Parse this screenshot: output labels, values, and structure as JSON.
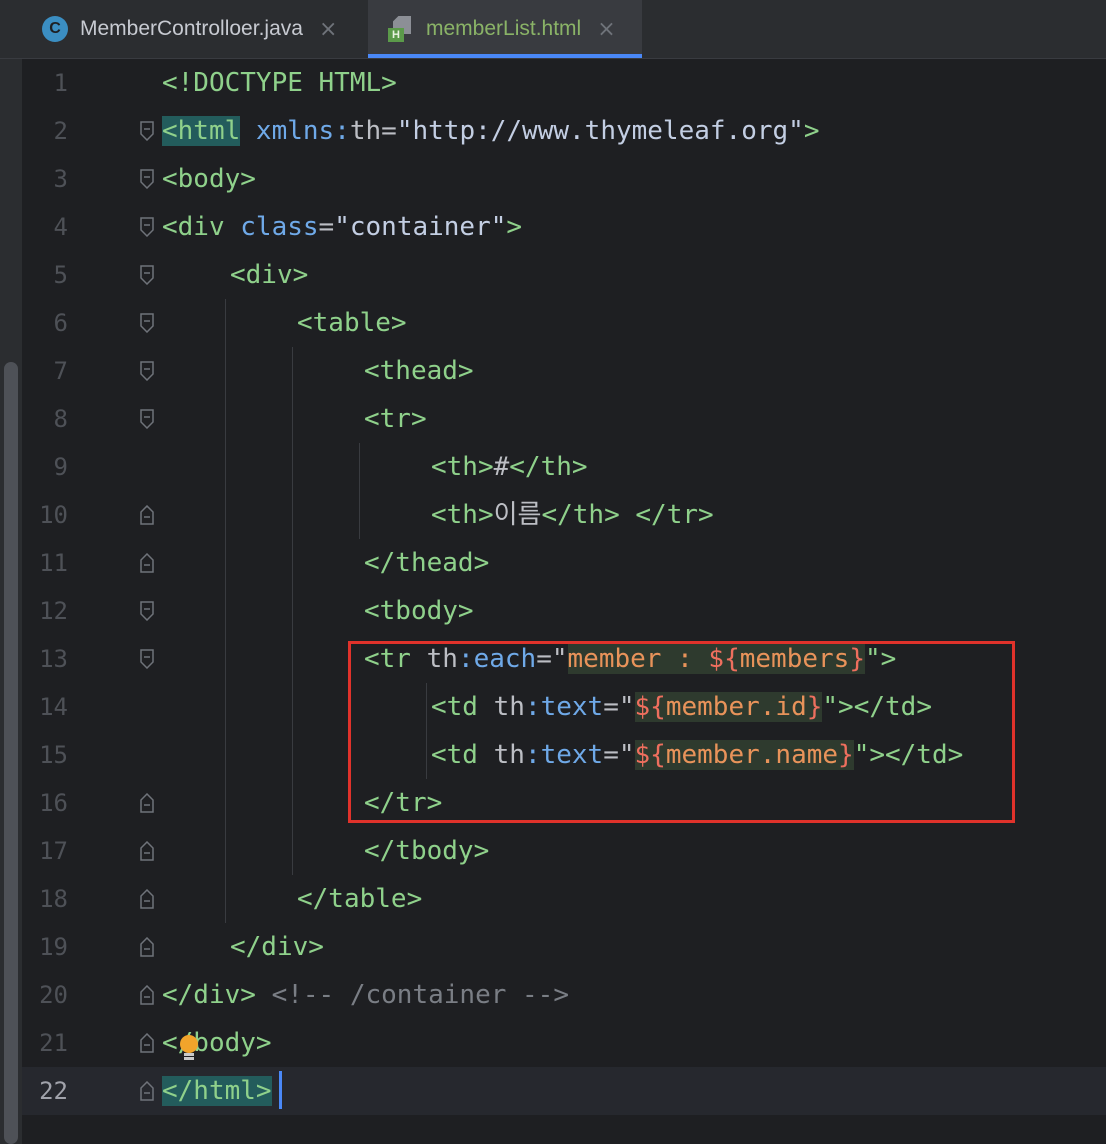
{
  "tabs": [
    {
      "label": "MemberControlloer.java",
      "icon": "java-class-icon",
      "active": false
    },
    {
      "label": "memberList.html",
      "icon": "html-file-icon",
      "active": true
    }
  ],
  "lines": [
    {
      "n": "1"
    },
    {
      "n": "2"
    },
    {
      "n": "3"
    },
    {
      "n": "4"
    },
    {
      "n": "5"
    },
    {
      "n": "6"
    },
    {
      "n": "7"
    },
    {
      "n": "8"
    },
    {
      "n": "9"
    },
    {
      "n": "10"
    },
    {
      "n": "11"
    },
    {
      "n": "12"
    },
    {
      "n": "13"
    },
    {
      "n": "14"
    },
    {
      "n": "15"
    },
    {
      "n": "16"
    },
    {
      "n": "17"
    },
    {
      "n": "18"
    },
    {
      "n": "19"
    },
    {
      "n": "20"
    },
    {
      "n": "21"
    },
    {
      "n": "22"
    }
  ],
  "code": {
    "l1": "<!DOCTYPE HTML>",
    "l2_tag": "<html",
    "l2_attr": " xmlns:",
    "l2_ns": "th",
    "l2_eq": "=",
    "l2_val": "\"http://www.thymeleaf.org\"",
    "l2_end": ">",
    "l3": "<body>",
    "l4_tag": "<div",
    "l4_attr": " class",
    "l4_eq": "=",
    "l4_val": "\"container\"",
    "l4_end": ">",
    "l5": "<div>",
    "l6": "<table>",
    "l7": "<thead>",
    "l8": "<tr>",
    "l9_open": "<th>",
    "l9_text": "#",
    "l9_close": "</th>",
    "l10_open": "<th>",
    "l10_text": "이름",
    "l10_close": "</th>",
    "l10_tr": " </tr>",
    "l11": "</thead>",
    "l12": "<tbody>",
    "l13_tag": "<tr",
    "l13_ns": " th",
    "l13_attr": ":each",
    "l13_eq": "=\"",
    "l13_var": "member : ",
    "l13_dollar": "${",
    "l13_expr": "members",
    "l13_brace": "}",
    "l13_end": "\">",
    "l14_tag": "<td",
    "l14_ns": " th",
    "l14_attr": ":text",
    "l14_eq": "=\"",
    "l14_dollar": "${",
    "l14_expr": "member.id",
    "l14_brace": "}",
    "l14_end": "\">",
    "l14_close": "</td>",
    "l15_tag": "<td",
    "l15_ns": " th",
    "l15_attr": ":text",
    "l15_eq": "=\"",
    "l15_dollar": "${",
    "l15_expr": "member.name",
    "l15_brace": "}",
    "l15_end": "\">",
    "l15_close": "</td>",
    "l16": "</tr>",
    "l17": "</tbody>",
    "l18": "</table>",
    "l19": "</div>",
    "l20_tag": "</div>",
    "l20_comment": " <!-- /container -->",
    "l21": "</body>",
    "l22": "</html>"
  },
  "colors": {
    "tag": "#8fd18b",
    "attribute": "#6fa9e8",
    "expression": "#e8935a",
    "highlight_box": "#e0322b",
    "caret": "#4a88f7"
  }
}
